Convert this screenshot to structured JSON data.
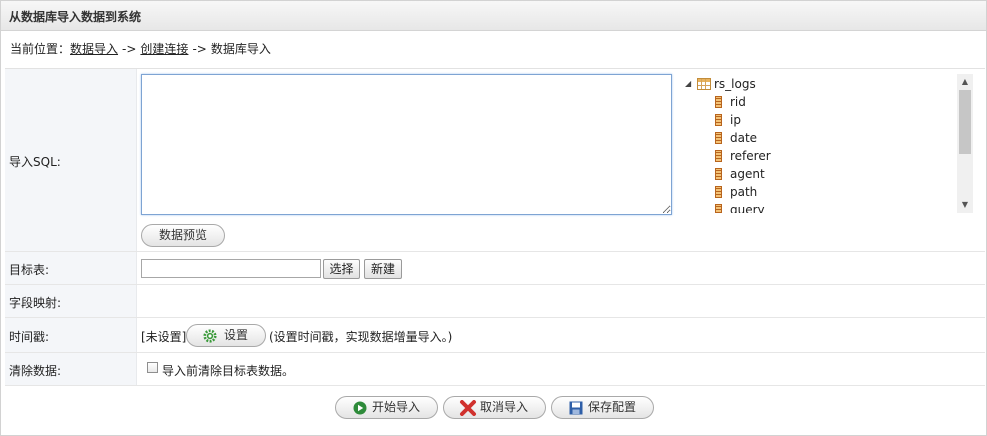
{
  "panel": {
    "title": "从数据库导入数据到系统"
  },
  "breadcrumb": {
    "prefix": "当前位置：",
    "items": [
      "数据导入",
      "创建连接",
      "数据库导入"
    ],
    "separator": "->"
  },
  "form": {
    "sql": {
      "label": "导入SQL:",
      "value": "",
      "preview_button": "数据预览"
    },
    "tree": {
      "table": "rs_logs",
      "columns": [
        "rid",
        "ip",
        "date",
        "referer",
        "agent",
        "path",
        "query"
      ]
    },
    "target": {
      "label": "目标表:",
      "value": "",
      "select_button": "选择",
      "new_button": "新建"
    },
    "mapping": {
      "label": "字段映射:"
    },
    "timestamp": {
      "label": "时间戳:",
      "status": "[未设置]",
      "set_button": "设置",
      "hint": "(设置时间戳，实现数据增量导入。)"
    },
    "clear": {
      "label": "清除数据:",
      "checkbox_label": "导入前清除目标表数据。",
      "checked": false
    }
  },
  "actions": {
    "start": "开始导入",
    "cancel": "取消导入",
    "save": "保存配置"
  },
  "colors": {
    "start_icon": "#2e8b3a",
    "cancel_icon": "#d0312d",
    "save_icon": "#2f5fa8",
    "gear_icon": "#3a9a3a"
  }
}
